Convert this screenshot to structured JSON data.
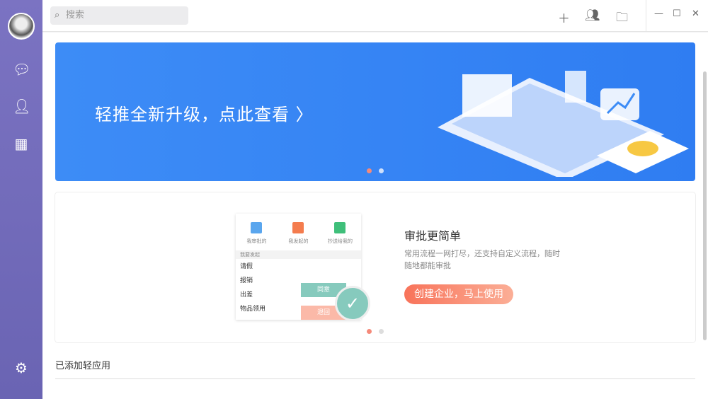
{
  "search": {
    "placeholder": "搜索"
  },
  "banner": {
    "text": "轻推全新升级，点此查看 〉"
  },
  "feature": {
    "title": "审批更简单",
    "desc": "常用流程一网打尽，还支持自定义流程，随时随地都能审批",
    "cta": "创建企业，马上使用",
    "phone": {
      "tabs": [
        "我审批的",
        "我发起的",
        "抄送给我的"
      ],
      "section": "我要发起",
      "rows": [
        "请假",
        "报销",
        "出差",
        "物品领用"
      ],
      "agree": "同意",
      "reject": "退回"
    }
  },
  "added_apps_label": "已添加轻应用",
  "colors": {
    "accent": "#3d8cf6",
    "sidebar": "#7b73c2",
    "cta": "#f8735a"
  }
}
